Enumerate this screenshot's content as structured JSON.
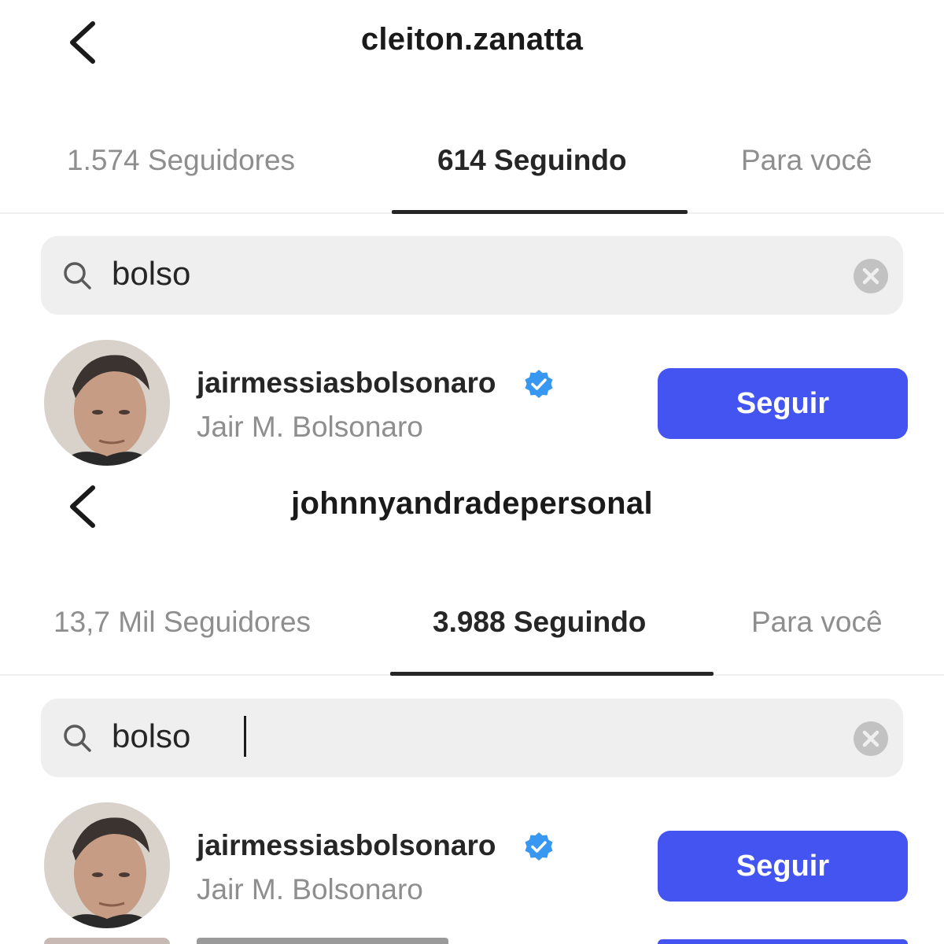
{
  "panels": [
    {
      "title": "cleiton.zanatta",
      "tabs": [
        {
          "label": "1.574 Seguidores",
          "active": false
        },
        {
          "label": "614 Seguindo",
          "active": true
        },
        {
          "label": "Para você",
          "active": false
        }
      ],
      "search": {
        "value": "bolso"
      },
      "result": {
        "username": "jairmessiasbolsonaro",
        "full_name": "Jair M. Bolsonaro",
        "follow_label": "Seguir",
        "verified": true
      }
    },
    {
      "title": "johnnyandradepersonal",
      "tabs": [
        {
          "label": "13,7 Mil Seguidores",
          "active": false
        },
        {
          "label": "3.988 Seguindo",
          "active": true
        },
        {
          "label": "Para você",
          "active": false
        }
      ],
      "search": {
        "value": "bolso"
      },
      "result": {
        "username": "jairmessiasbolsonaro",
        "full_name": "Jair M. Bolsonaro",
        "follow_label": "Seguir",
        "verified": true
      }
    }
  ],
  "colors": {
    "follow_button": "#4454f0",
    "verified_badge": "#3897f0",
    "muted_text": "#8e8e8e",
    "search_bg": "#efefef"
  },
  "icons": {
    "back": "chevron-left-icon",
    "search": "search-icon",
    "clear": "clear-circle-icon",
    "verified": "verified-badge-icon"
  }
}
